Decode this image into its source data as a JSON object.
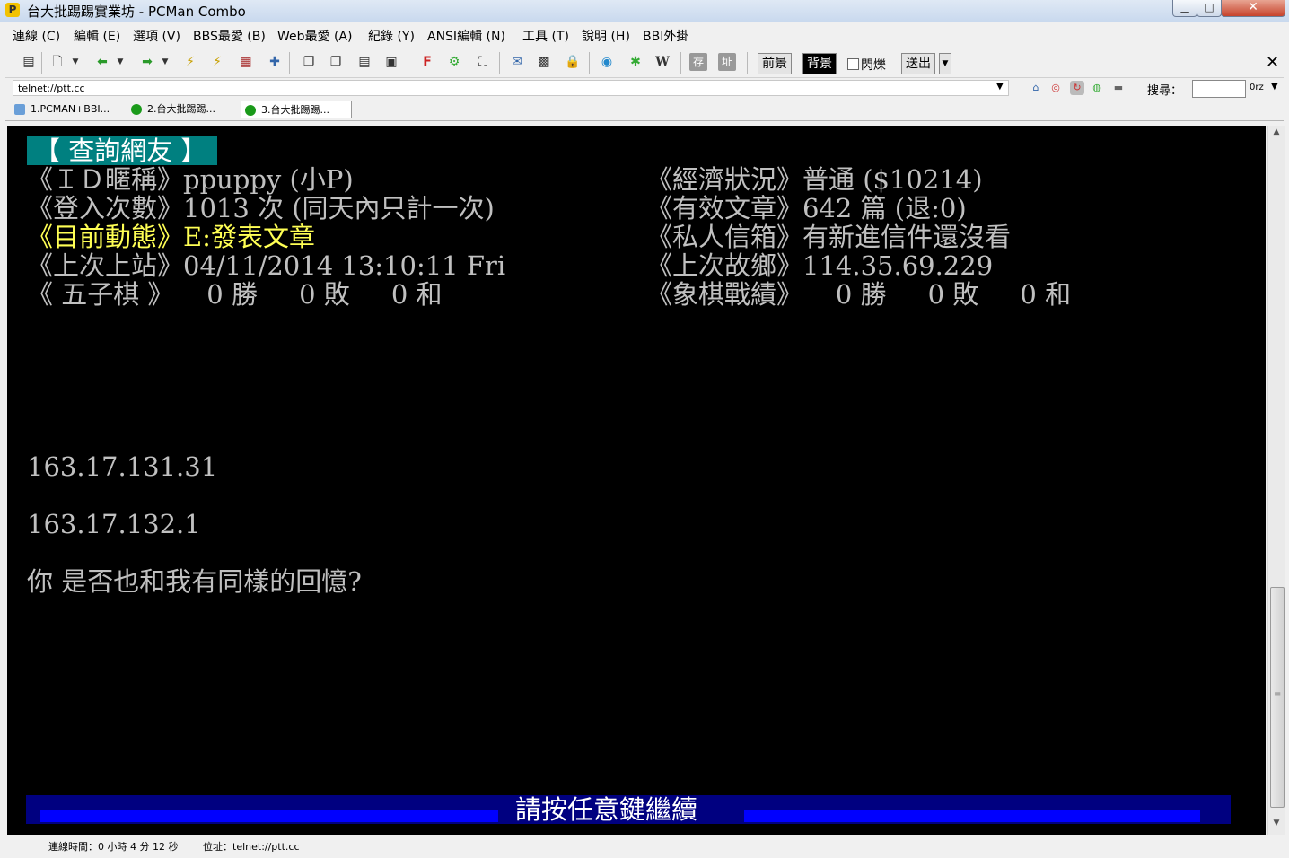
{
  "window": {
    "title": "台大批踢踢實業坊 - PCMan Combo",
    "app_icon": "pcman-logo-icon"
  },
  "menubar": [
    "連線 (C)",
    "編輯 (E)",
    "選項 (V)",
    "BBS最愛 (B)",
    "Web最愛 (A)",
    "紀錄 (Y)",
    "ANSI編輯 (N)",
    "工具 (T)",
    "說明 (H)",
    "BBI外掛"
  ],
  "toolbar": {
    "fg_label": "前景",
    "bg_label": "背景",
    "blink_label": "閃爍",
    "send_label": "送出"
  },
  "address": {
    "value": "telnet://ptt.cc",
    "search_label": "搜尋：",
    "search_engine": "0rz"
  },
  "tabs": [
    {
      "label": "1.PCMAN+BBI...",
      "icon": "page-icon"
    },
    {
      "label": "2.台大批踢踢...",
      "icon": "green-dot-icon"
    },
    {
      "label": "3.台大批踢踢...",
      "icon": "green-dot-icon",
      "active": true
    }
  ],
  "terminal": {
    "title": "【 查詢網友 】",
    "rows": [
      {
        "left": "《ＩＤ暱稱》ppuppy (小P)",
        "right": "《經濟狀況》普通 ($10214)"
      },
      {
        "left": "《登入次數》1013 次 (同天內只計一次)",
        "right": "《有效文章》642 篇 (退:0)"
      },
      {
        "left": "《目前動態》E:發表文章",
        "right": "《私人信箱》有新進信件還沒看"
      },
      {
        "left": "《上次上站》04/11/2014 13:10:11 Fri",
        "right": "《上次故鄉》114.35.69.229"
      },
      {
        "left": "《 五子棋 》    0 勝     0 敗     0 和",
        "right": "《象棋戰績》    0 勝     0 敗     0 和"
      }
    ],
    "plan_lines": [
      "163.17.131.31",
      "163.17.132.1",
      "你 是否也和我有同樣的回憶?"
    ],
    "footer": "請按任意鍵繼續"
  },
  "statusbar": {
    "time": "連線時間：0 小時 4 分 12 秒",
    "addr": "位址：telnet://ptt.cc"
  },
  "colors": {
    "terminal_bg": "#000000",
    "terminal_fg": "#c0c0c0",
    "title_bg": "#008080",
    "highlight_yellow": "#ffff54",
    "footer_bg": "#000080"
  }
}
